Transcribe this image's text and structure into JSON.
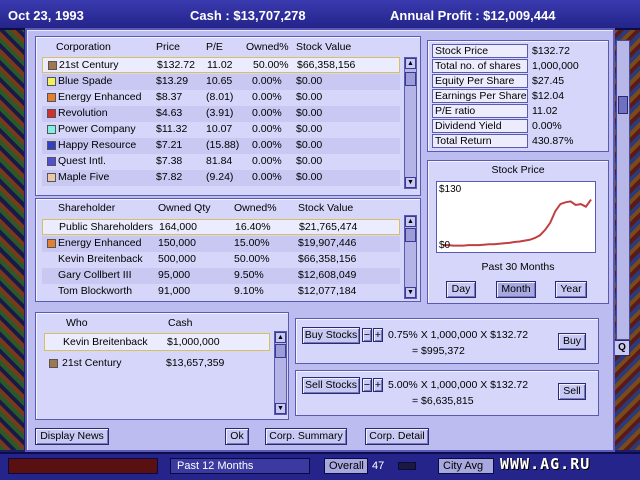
{
  "topbar": {
    "date": "Oct 23, 1993",
    "cash": "Cash : $13,707,278",
    "annual_profit": "Annual Profit : $12,009,444"
  },
  "corporations": {
    "headers": {
      "corporation": "Corporation",
      "price": "Price",
      "pe": "P/E",
      "owned": "Owned%",
      "stock_value": "Stock Value"
    },
    "rows": [
      {
        "name": "21st Century",
        "price": "$132.72",
        "pe": "11.02",
        "owned": "50.00%",
        "value": "$66,358,156",
        "color": "#a07850"
      },
      {
        "name": "Blue Spade",
        "price": "$13.29",
        "pe": "10.65",
        "owned": "0.00%",
        "value": "$0.00",
        "color": "#f0f060"
      },
      {
        "name": "Energy Enhanced",
        "price": "$8.37",
        "pe": "(8.01)",
        "owned": "0.00%",
        "value": "$0.00",
        "color": "#e08030"
      },
      {
        "name": "Revolution",
        "price": "$4.63",
        "pe": "(3.91)",
        "owned": "0.00%",
        "value": "$0.00",
        "color": "#d03030"
      },
      {
        "name": "Power Company",
        "price": "$11.32",
        "pe": "10.07",
        "owned": "0.00%",
        "value": "$0.00",
        "color": "#80f0e0"
      },
      {
        "name": "Happy Resource",
        "price": "$7.21",
        "pe": "(15.88)",
        "owned": "0.00%",
        "value": "$0.00",
        "color": "#3040c0"
      },
      {
        "name": "Quest Intl.",
        "price": "$7.38",
        "pe": "81.84",
        "owned": "0.00%",
        "value": "$0.00",
        "color": "#5050d0"
      },
      {
        "name": "Maple Five",
        "price": "$7.82",
        "pe": "(9.24)",
        "owned": "0.00%",
        "value": "$0.00",
        "color": "#e8c8a8"
      }
    ]
  },
  "shareholders": {
    "headers": {
      "shareholder": "Shareholder",
      "qty": "Owned Qty",
      "owned": "Owned%",
      "stock_value": "Stock Value"
    },
    "rows": [
      {
        "name": "Public Shareholders",
        "qty": "164,000",
        "owned": "16.40%",
        "value": "$21,765,474",
        "color": ""
      },
      {
        "name": "Energy Enhanced",
        "qty": "150,000",
        "owned": "15.00%",
        "value": "$19,907,446",
        "color": "#e08030"
      },
      {
        "name": "Kevin Breitenback",
        "qty": "500,000",
        "owned": "50.00%",
        "value": "$66,358,156",
        "color": ""
      },
      {
        "name": "Gary Collbert III",
        "qty": "95,000",
        "owned": "9.50%",
        "value": "$12,608,049",
        "color": ""
      },
      {
        "name": "Tom Blockworth",
        "qty": "91,000",
        "owned": "9.10%",
        "value": "$12,077,184",
        "color": ""
      }
    ]
  },
  "stats": [
    {
      "label": "Stock Price",
      "value": "$132.72"
    },
    {
      "label": "Total no. of shares",
      "value": "1,000,000"
    },
    {
      "label": "Equity Per Share",
      "value": "$27.45"
    },
    {
      "label": "Earnings Per Share",
      "value": "$12.04"
    },
    {
      "label": "P/E ratio",
      "value": "11.02"
    },
    {
      "label": "Dividend Yield",
      "value": "0.00%"
    },
    {
      "label": "Total Return",
      "value": "430.87%"
    }
  ],
  "chart_data": {
    "type": "line",
    "title": "Stock Price",
    "caption": "Past 30 Months",
    "ytop_label": "$130",
    "ybottom_label": "$0",
    "ylim": [
      0,
      130
    ],
    "x": [
      1,
      2,
      3,
      4,
      5,
      6,
      7,
      8,
      9,
      10,
      11,
      12,
      13,
      14,
      15,
      16,
      17,
      18,
      19,
      20,
      21,
      22,
      23,
      24,
      25,
      26,
      27,
      28,
      29,
      30
    ],
    "values": [
      2,
      2,
      1,
      1,
      1,
      2,
      2,
      2,
      3,
      4,
      4,
      5,
      6,
      7,
      9,
      10,
      12,
      14,
      18,
      24,
      36,
      52,
      78,
      94,
      98,
      100,
      92,
      94,
      88,
      104
    ],
    "line_color": "#c04040",
    "period_buttons": [
      "Day",
      "Month",
      "Year"
    ],
    "active_period": "Month"
  },
  "cash_table": {
    "headers": {
      "who": "Who",
      "cash": "Cash"
    },
    "rows": [
      {
        "name": "Kevin Breitenback",
        "cash": "$1,000,000",
        "color": ""
      },
      {
        "name": "21st Century",
        "cash": "$13,657,359",
        "color": "#a07850"
      }
    ]
  },
  "buy": {
    "label": "Buy Stocks",
    "minus": "−",
    "plus": "+",
    "formula": "0.75% X 1,000,000 X $132.72",
    "result": "= $995,372",
    "button": "Buy"
  },
  "sell": {
    "label": "Sell Stocks",
    "minus": "−",
    "plus": "+",
    "formula": "5.00% X 1,000,000 X $132.72",
    "result": "= $6,635,815",
    "button": "Sell"
  },
  "footer_buttons": {
    "display_news": "Display News",
    "ok": "Ok",
    "corp_summary": "Corp. Summary",
    "corp_detail": "Corp. Detail"
  },
  "bottombar": {
    "past": "Past 12 Months",
    "overall_label": "Overall",
    "overall_value": "47",
    "city_avg_label": "City Avg"
  },
  "watermark": "WWW.AG.RU",
  "q_button": "Q"
}
